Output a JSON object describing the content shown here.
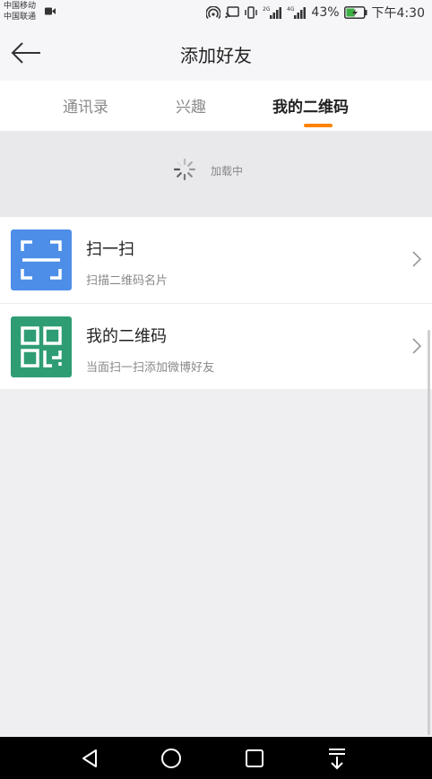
{
  "status_bar": {
    "carrier_1": "中国移动",
    "carrier_2": "中国联通",
    "net_badge_1": "2G",
    "net_badge_2": "4G",
    "battery_percent": "43%",
    "time": "下午4:30"
  },
  "header": {
    "title": "添加好友",
    "back_icon": "arrow-left-icon"
  },
  "tabs": [
    {
      "label": "通讯录",
      "active": false
    },
    {
      "label": "兴趣",
      "active": false
    },
    {
      "label": "我的二维码",
      "active": true
    }
  ],
  "colors": {
    "accent": "#ff8200",
    "scan_icon_bg": "#4d8ee8",
    "qr_icon_bg": "#2f9d74"
  },
  "loading": {
    "text": "加载中"
  },
  "list": [
    {
      "title": "扫一扫",
      "subtitle": "扫描二维码名片",
      "icon": "scan-icon"
    },
    {
      "title": "我的二维码",
      "subtitle": "当面扫一扫添加微博好友",
      "icon": "qr-code-icon"
    }
  ]
}
